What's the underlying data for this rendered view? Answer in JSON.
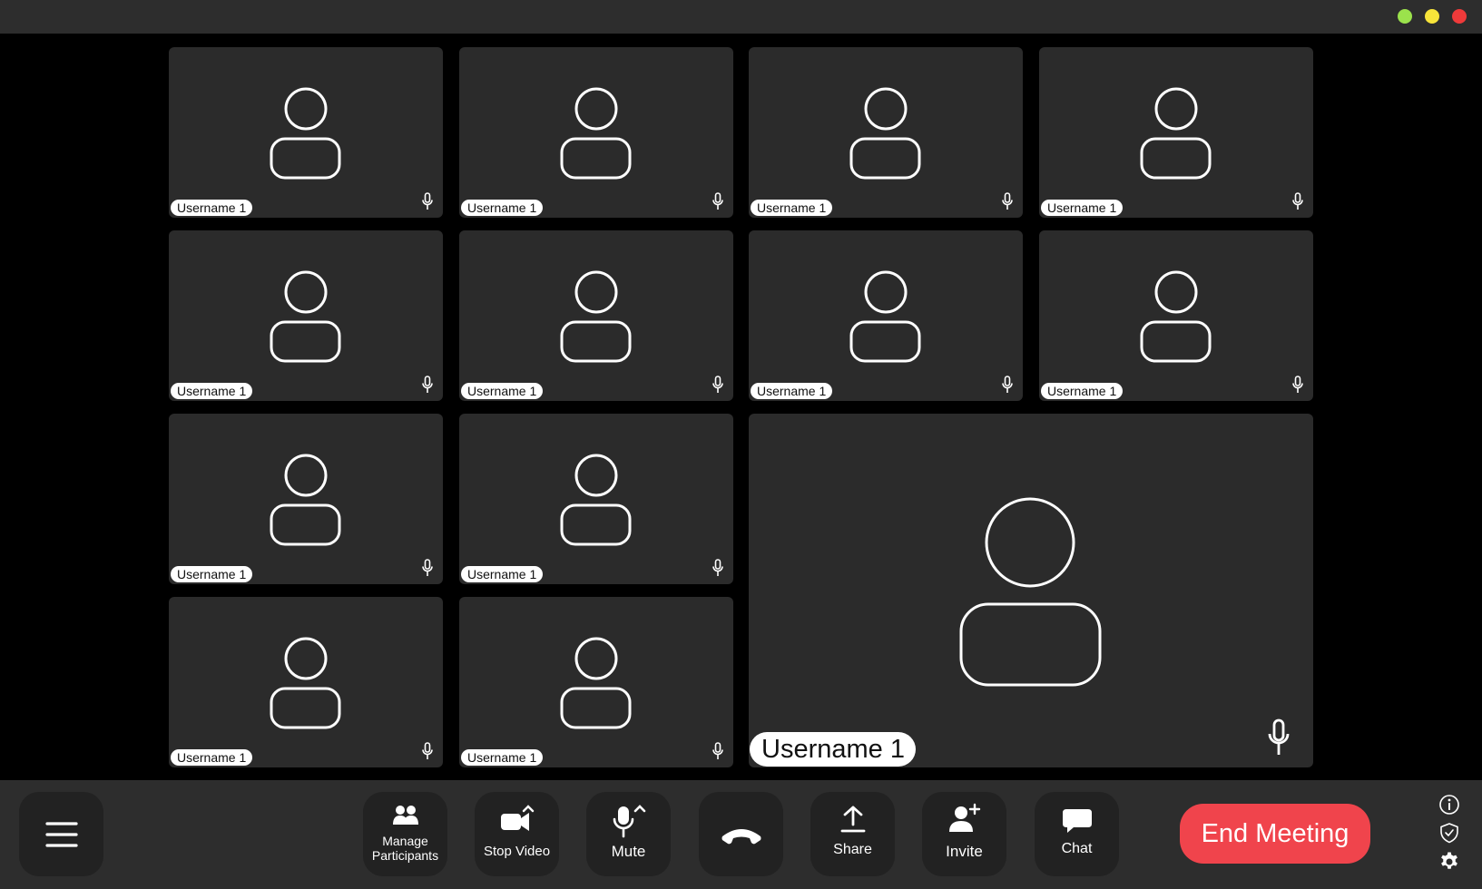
{
  "window": {
    "controls": [
      {
        "name": "maximize",
        "color": "#9be24c"
      },
      {
        "name": "minimize",
        "color": "#f7e43a"
      },
      {
        "name": "close",
        "color": "#ef3a3a"
      }
    ]
  },
  "participants": [
    {
      "username": "Username 1",
      "mic": "mic-icon"
    },
    {
      "username": "Username 1",
      "mic": "mic-icon"
    },
    {
      "username": "Username 1",
      "mic": "mic-icon"
    },
    {
      "username": "Username 1",
      "mic": "mic-icon"
    },
    {
      "username": "Username 1",
      "mic": "mic-icon"
    },
    {
      "username": "Username 1",
      "mic": "mic-icon"
    },
    {
      "username": "Username 1",
      "mic": "mic-icon"
    },
    {
      "username": "Username 1",
      "mic": "mic-icon"
    },
    {
      "username": "Username 1",
      "mic": "mic-icon"
    },
    {
      "username": "Username 1",
      "mic": "mic-icon"
    },
    {
      "username": "Username 1",
      "mic": "mic-icon"
    },
    {
      "username": "Username 1",
      "mic": "mic-icon"
    }
  ],
  "active_speaker": {
    "username": "Username 1",
    "mic": "mic-icon"
  },
  "toolbar": {
    "menu_icon": "hamburger-menu-icon",
    "manage_participants_line1": "Manage",
    "manage_participants_line2": "Participants",
    "stop_video_label": "Stop Video",
    "mute_label": "Mute",
    "leave_icon": "phone-hangup-icon",
    "share_label": "Share",
    "invite_label": "Invite",
    "chat_label": "Chat",
    "end_meeting_label": "End Meeting"
  },
  "side_icons": [
    "info-icon",
    "shield-icon",
    "gear-icon"
  ],
  "colors": {
    "end_meeting": "#f0444c",
    "tile_bg": "#2b2b2b",
    "toolbar_bg": "#2d2d2d"
  }
}
